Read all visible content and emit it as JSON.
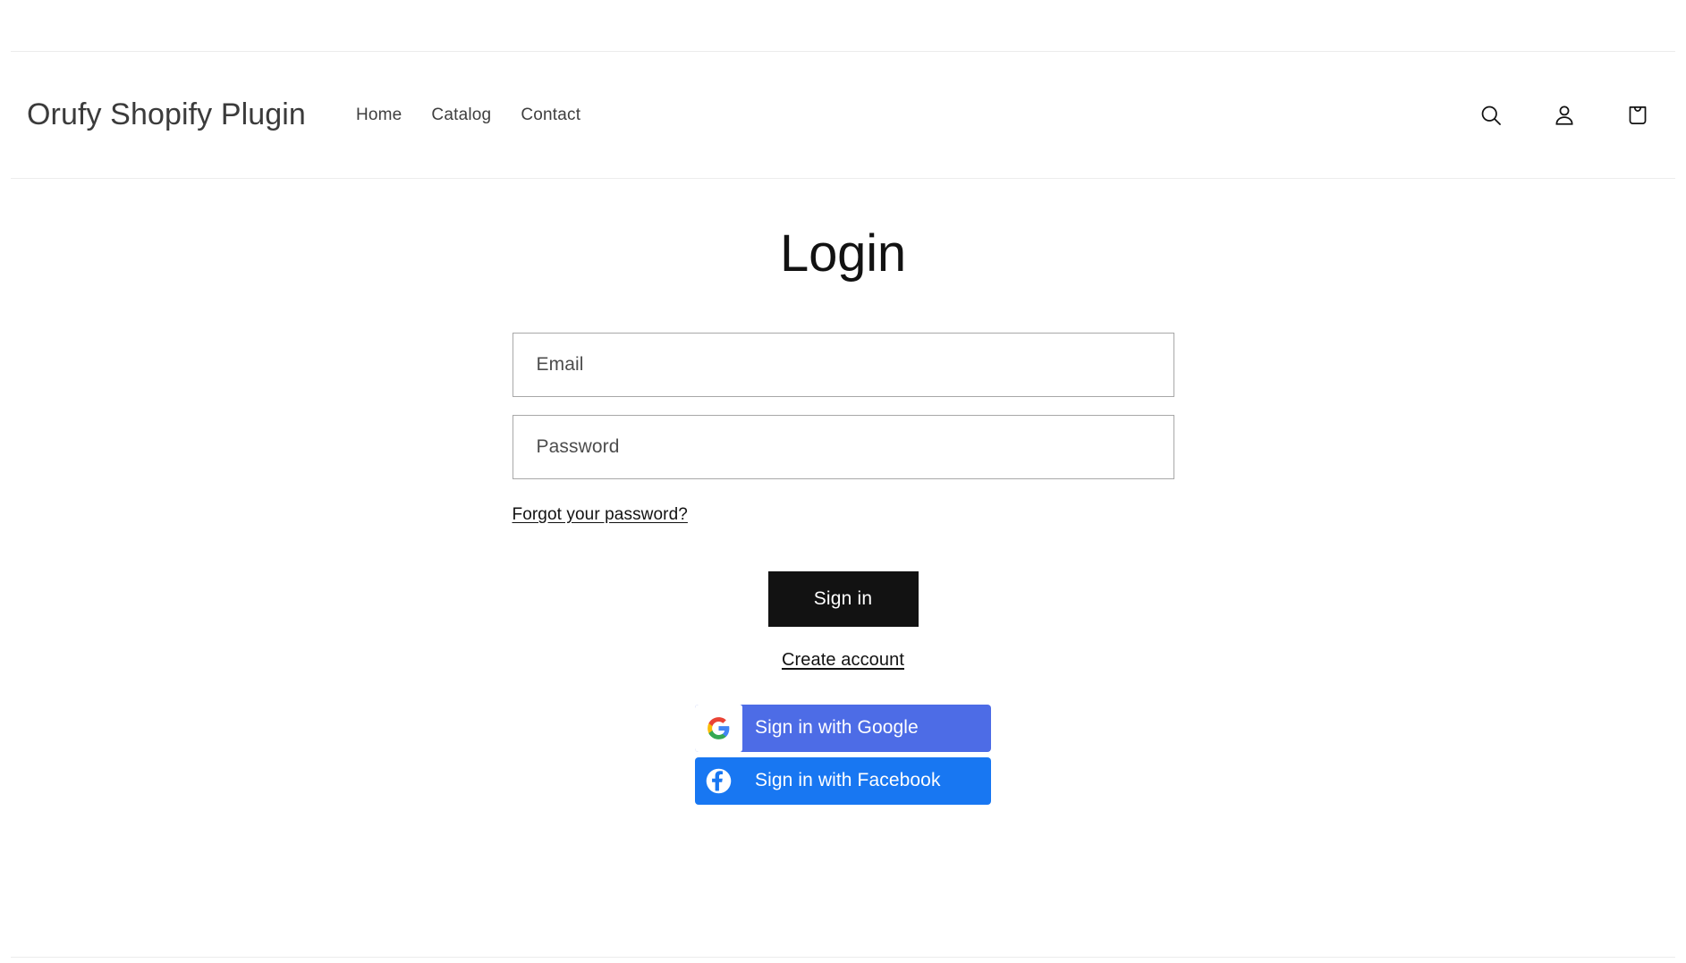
{
  "announcement": {
    "text": ""
  },
  "header": {
    "logo": "Orufy Shopify Plugin",
    "nav": [
      {
        "label": "Home"
      },
      {
        "label": "Catalog"
      },
      {
        "label": "Contact"
      }
    ],
    "actions": [
      {
        "name": "search-icon",
        "label": "Search"
      },
      {
        "name": "account-icon",
        "label": "Log in"
      },
      {
        "name": "cart-icon",
        "label": "Cart"
      }
    ]
  },
  "main": {
    "title": "Login",
    "form": {
      "email": {
        "placeholder": "Email",
        "value": ""
      },
      "password": {
        "placeholder": "Password",
        "value": ""
      },
      "forgot_password_label": "Forgot your password?",
      "submit_label": "Sign in",
      "create_account_label": "Create account"
    },
    "social": [
      {
        "label": "Sign in with Google",
        "icon": "google-g-icon",
        "color": "#4d6ce6"
      },
      {
        "label": "Sign in with Facebook",
        "icon": "facebook-f-icon",
        "color": "#1877f2"
      }
    ]
  },
  "colors": {
    "text": "#121212",
    "border": "#a8a8a8",
    "rule": "#ececec",
    "button_primary": "#121212",
    "google_blue": "#4d6ce6",
    "facebook_blue": "#1877f2"
  }
}
